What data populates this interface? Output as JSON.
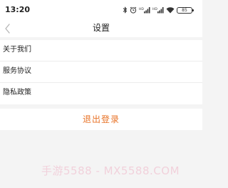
{
  "status_bar": {
    "time": "13:20",
    "battery": "85",
    "icons": [
      "bluetooth-icon",
      "alarm-icon",
      "signal-hd-icon",
      "signal-hd-icon",
      "wifi-icon",
      "battery-icon"
    ]
  },
  "nav": {
    "back_icon": "chevron-left-icon",
    "title": "设置"
  },
  "menu": {
    "items": [
      {
        "label": "关于我们"
      },
      {
        "label": "服务协议"
      },
      {
        "label": "隐私政策"
      }
    ]
  },
  "logout": {
    "label": "退出登录",
    "color": "#e87327"
  },
  "watermark": {
    "text": "手游5588 - MX5588.COM"
  }
}
